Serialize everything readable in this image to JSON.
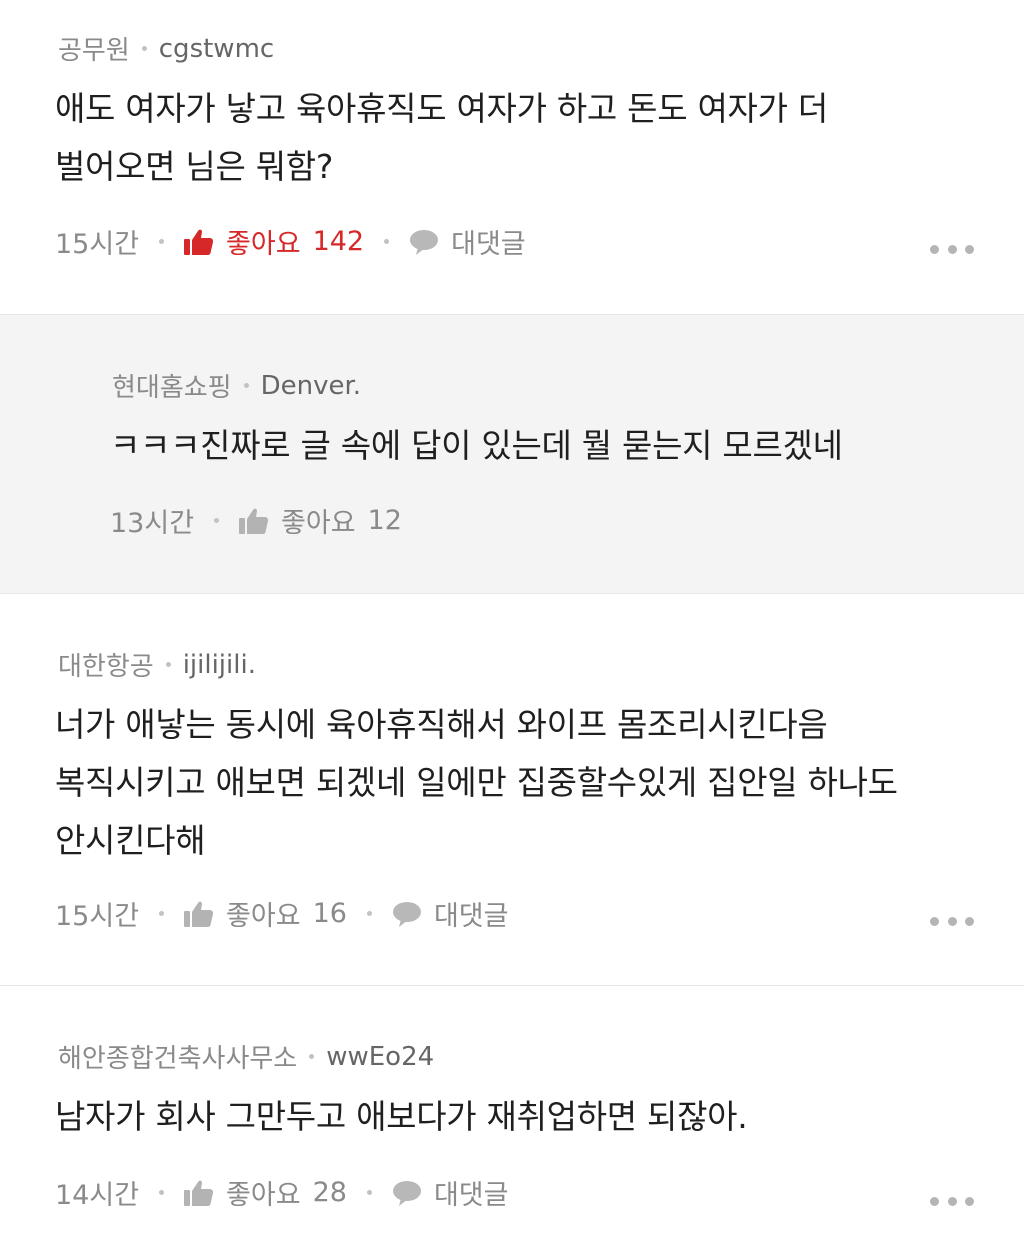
{
  "comments": [
    {
      "company": "공무원",
      "user": "cgstwmc",
      "lines": [
        "애도 여자가 낳고 육아휴직도 여자가 하고 돈도 여자가 더",
        "벌어오면 님은 뭐함?"
      ],
      "time": "15시간",
      "like_label": "좋아요",
      "like_count": "142",
      "reply_label": "대댓글"
    },
    {
      "company": "현대홈쇼핑",
      "user": "Denver.",
      "lines": [
        "ㅋㅋㅋ진짜로 글 속에 답이 있는데 뭘 묻는지 모르겠네"
      ],
      "time": "13시간",
      "like_label": "좋아요",
      "like_count": "12"
    },
    {
      "company": "대한항공",
      "user": "ijilijili.",
      "lines": [
        "너가 애낳는 동시에  육아휴직해서 와이프 몸조리시킨다음",
        "복직시키고 애보면 되겠네 일에만 집중할수있게 집안일 하나도",
        "안시킨다해"
      ],
      "time": "15시간",
      "like_label": "좋아요",
      "like_count": "16",
      "reply_label": "대댓글"
    },
    {
      "company": "해안종합건축사사무소",
      "user": "wwEo24",
      "lines": [
        "남자가 회사 그만두고 애보다가 재취업하면 되잖아."
      ],
      "time": "14시간",
      "like_label": "좋아요",
      "like_count": "28",
      "reply_label": "대댓글"
    }
  ],
  "colors": {
    "liked": "#d62828",
    "muted": "#8a8a8a",
    "reply_bg": "#f4f4f4"
  },
  "icons": {
    "like": "thumbs-up-icon",
    "reply": "speech-bubble-icon",
    "more": "more-dots-icon"
  }
}
